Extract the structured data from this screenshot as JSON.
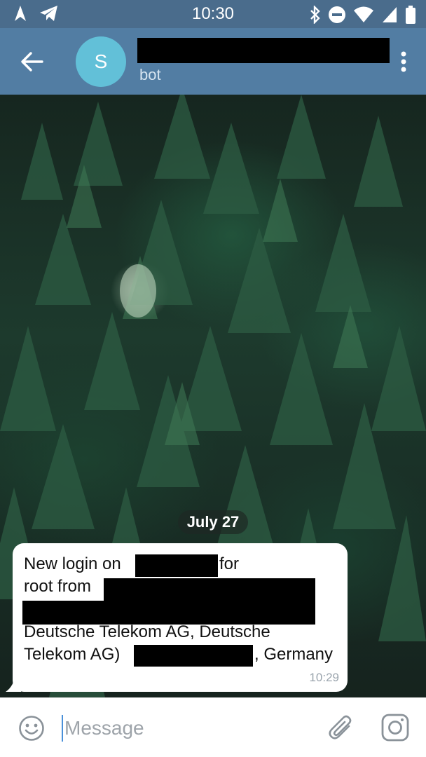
{
  "status_bar": {
    "time": "10:30"
  },
  "header": {
    "avatar_letter": "S",
    "subtitle": "bot"
  },
  "chat": {
    "date": "July 27",
    "message": {
      "line1_a": "New login on",
      "line1_b": "for",
      "line2": "root from",
      "line4": "Deutsche Telekom AG, Deutsche",
      "line5_a": "Telekom AG)",
      "line5_b": ", Germany",
      "time": "10:29"
    }
  },
  "composer": {
    "placeholder": "Message"
  },
  "icons": {
    "status_left": [
      "navigation-icon",
      "telegram-icon"
    ],
    "status_right": [
      "bluetooth-icon",
      "do-not-disturb-icon",
      "wifi-icon",
      "signal-icon",
      "battery-icon"
    ],
    "header": [
      "back-arrow-icon",
      "more-vert-icon"
    ],
    "composer": [
      "emoji-icon",
      "attach-icon",
      "camera-icon"
    ]
  },
  "colors": {
    "status_bar": "#4a6c8c",
    "app_bar": "#527da3",
    "avatar": "#62c0d8",
    "cursor": "#4a90d9"
  }
}
